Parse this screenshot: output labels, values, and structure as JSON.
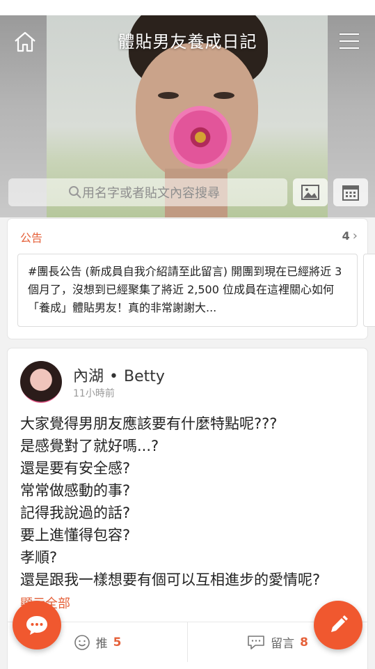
{
  "header": {
    "title": "體貼男友養成日記"
  },
  "search": {
    "placeholder": "用名字或者貼文內容搜尋"
  },
  "notice": {
    "title": "公告",
    "count": "4",
    "text": "#團長公告 (新成員自我介紹請至此留言) 開團到現在已經將近 3 個月了，沒想到已經聚集了將近 2,500 位成員在這裡關心如何「養成」體貼男友！真的非常謝謝大..."
  },
  "post": {
    "author_location": "內湖",
    "author_separator": "•",
    "author_name": "Betty",
    "time": "11小時前",
    "lines": [
      "大家覺得男朋友應該要有什麼特點呢???",
      "是感覺對了就好嗎...?",
      "還是要有安全感?",
      "常常做感動的事?",
      "記得我說過的話?",
      "要上進懂得包容?",
      "孝順?",
      "還是跟我一樣想要有個可以互相進步的愛情呢?"
    ],
    "show_all": "顯示全部",
    "like_label": "推",
    "like_count": "5",
    "comment_label": "留言",
    "comment_count": "8"
  },
  "colors": {
    "accent": "#f0582f",
    "accent_text": "#e5613a"
  }
}
